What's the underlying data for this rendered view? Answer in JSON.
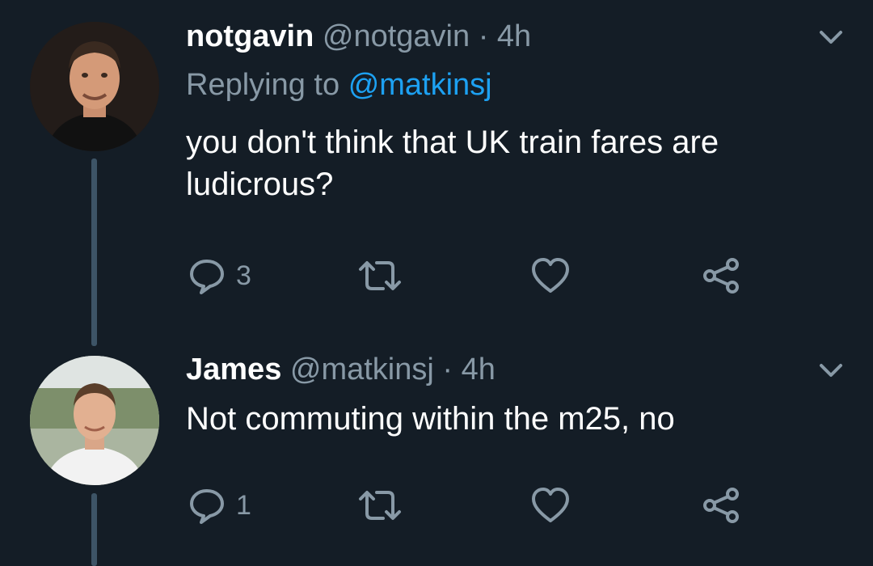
{
  "tweets": [
    {
      "name": "notgavin",
      "handle": "@notgavin",
      "separator": "·",
      "time": "4h",
      "replying_prefix": "Replying to",
      "replying_to": "@matkinsj",
      "text": "you don't think that UK train fares are ludicrous?",
      "reply_count": "3",
      "icons": [
        "reply-icon",
        "retweet-icon",
        "like-icon",
        "share-icon",
        "chevron-down-icon"
      ]
    },
    {
      "name": "James",
      "handle": "@matkinsj",
      "separator": "·",
      "time": "4h",
      "text": "Not commuting within the m25, no",
      "reply_count": "1",
      "icons": [
        "reply-icon",
        "retweet-icon",
        "like-icon",
        "share-icon",
        "chevron-down-icon"
      ]
    }
  ],
  "colors": {
    "background": "#141d26",
    "secondary_text": "#8899a6",
    "link": "#1da1f2",
    "thread_line": "#3d5466"
  }
}
